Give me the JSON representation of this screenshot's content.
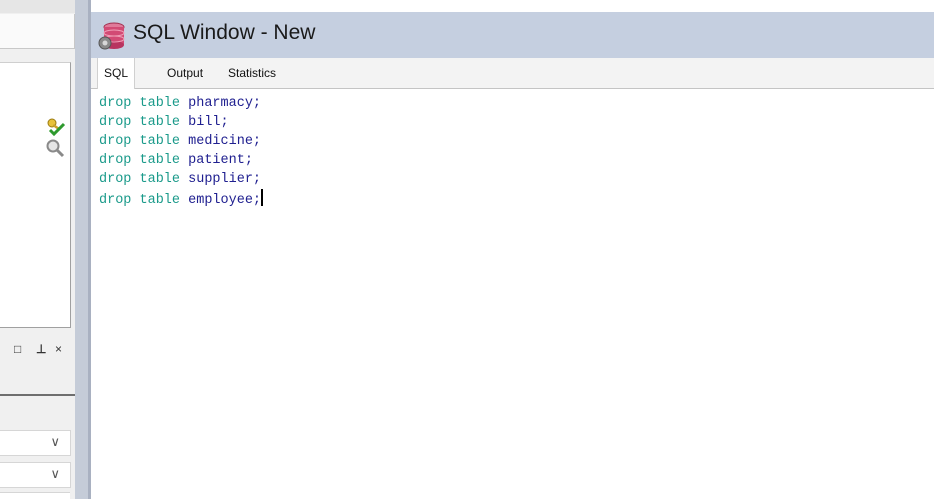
{
  "window": {
    "title": "SQL Window - New"
  },
  "tabs": [
    {
      "label": "SQL",
      "active": true
    },
    {
      "label": "Output",
      "active": false
    },
    {
      "label": "Statistics",
      "active": false
    }
  ],
  "editor": {
    "keyword_color": "#1a9a8a",
    "identifier_color": "#202090",
    "lines": [
      {
        "keywords": "drop table ",
        "identifier": "pharmacy;"
      },
      {
        "keywords": "drop table ",
        "identifier": "bill;"
      },
      {
        "keywords": "drop table ",
        "identifier": "medicine;"
      },
      {
        "keywords": "drop table ",
        "identifier": "patient;"
      },
      {
        "keywords": "drop table ",
        "identifier": "supplier;"
      },
      {
        "keywords": "drop table ",
        "identifier": "employee;"
      }
    ]
  },
  "left_panel": {
    "icons": [
      "key-check-icon",
      "search-icon"
    ],
    "pane_controls": [
      "□",
      "⊥",
      "×"
    ],
    "dropdowns": [
      {
        "chevron": "∨"
      },
      {
        "chevron": "∨"
      }
    ]
  }
}
